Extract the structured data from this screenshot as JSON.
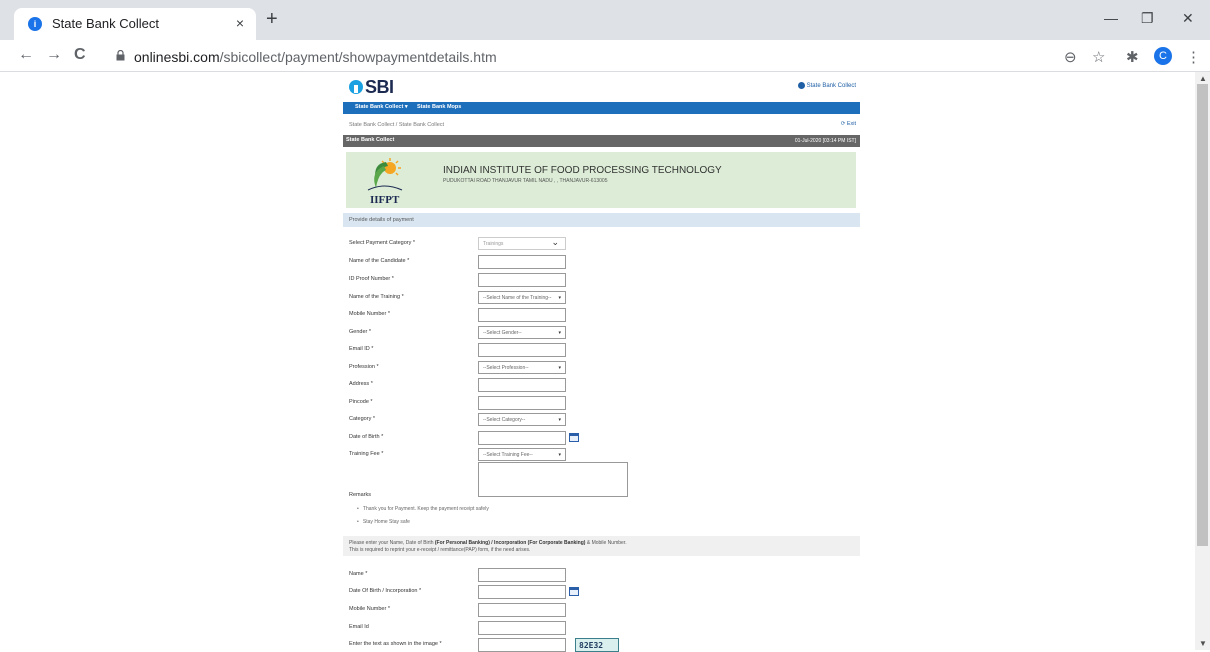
{
  "browser": {
    "tab_title": "State Bank Collect",
    "tab_close": "×",
    "new_tab": "+",
    "url_host": "onlinesbi.com",
    "url_path": "/sbicollect/payment/showpaymentdetails.htm",
    "profile_initial": "C",
    "window_controls": {
      "minimize": "—",
      "restore": "❐",
      "close": "✕"
    },
    "nav": {
      "back": "←",
      "forward": "→",
      "reload": "C"
    },
    "toolbar_icons": {
      "zoom": "⊖",
      "star": "☆",
      "extensions": "✱",
      "menu": "⋮"
    }
  },
  "header": {
    "logo_text": "SBI",
    "right_link": "State Bank Collect"
  },
  "navbar": {
    "items": [
      "State Bank Collect ▾",
      "State Bank Mops"
    ]
  },
  "breadcrumb": "State Bank Collect  /  State Bank Collect",
  "exit_label": "⟳ Exit",
  "section_bar": {
    "title": "State Bank Collect",
    "datetime": "01-Jul-2020 [03:14 PM IST]"
  },
  "institution": {
    "logo_text": "IIFPT",
    "name": "INDIAN INSTITUTE OF FOOD PROCESSING TECHNOLOGY",
    "address": "PUDUKOTTAI ROAD THANJAVUR TAMIL NADU , , THANJAVUR-613005"
  },
  "provide_label": "Provide details of payment",
  "form": {
    "payment_category": {
      "label": "Select Payment Category *",
      "value": "Trainings"
    },
    "candidate_name": {
      "label": "Name of the Candidate *"
    },
    "id_proof": {
      "label": "ID Proof Number *"
    },
    "training_name": {
      "label": "Name of the Training *",
      "value": "--Select Name of the Training--"
    },
    "mobile": {
      "label": "Mobile Number *"
    },
    "gender": {
      "label": "Gender *",
      "value": "--Select Gender--"
    },
    "email": {
      "label": "Email ID *"
    },
    "profession": {
      "label": "Profession *",
      "value": "--Select Profession--"
    },
    "address": {
      "label": "Address *"
    },
    "pincode": {
      "label": "Pincode *"
    },
    "category": {
      "label": "Category *",
      "value": "--Select Category--"
    },
    "dob": {
      "label": "Date of Birth *"
    },
    "training_fee": {
      "label": "Training Fee *",
      "value": "--Select Training Fee--"
    },
    "remarks": {
      "label": "Remarks"
    }
  },
  "bullets": [
    "Thank you for Payment. Keep the payment receipt safely",
    "Stay Home Stay safe"
  ],
  "notice": {
    "line1_pre": "Please enter your Name, Date of Birth ",
    "line1_bold1": "(For Personal Banking) / Incorporation (For Corporate Banking)",
    "line1_post": " & Mobile Number.",
    "line2": "This is required to reprint your e-receipt / remittance(PAP) form, if the need arises."
  },
  "reprint": {
    "name": {
      "label": "Name *"
    },
    "dob": {
      "label": "Date Of Birth / Incorporation *"
    },
    "mobile": {
      "label": "Mobile Number *"
    },
    "email": {
      "label": "Email Id"
    },
    "captcha": {
      "label": "Enter the text as shown in the image *",
      "code": "82E32"
    }
  }
}
